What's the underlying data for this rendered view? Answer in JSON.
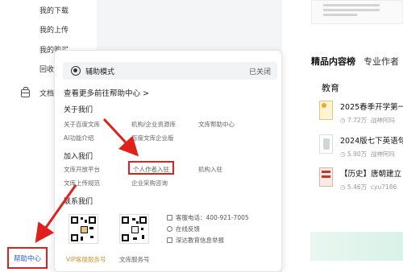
{
  "sidebar": {
    "items": [
      {
        "label": "我的下载"
      },
      {
        "label": "我的上传"
      },
      {
        "label": "我的购买"
      },
      {
        "label": "回收站"
      }
    ],
    "doc_label": "文档",
    "help_center": "帮助中心"
  },
  "popup": {
    "accessibility_label": "辅助模式",
    "accessibility_status": "已关闭",
    "more_link": "查看更多前往帮助中心 >",
    "about": {
      "title": "关于我们",
      "links": [
        "关于百度文库",
        "机构/企业资源库",
        "文库帮助中心",
        "AI功能介绍",
        "百度文库企业版"
      ]
    },
    "join": {
      "title": "加入我们",
      "links": [
        "文库开放平台",
        "个人作者入驻",
        "机构入驻",
        "文库上传规范",
        "企业采购咨询"
      ]
    },
    "contact": {
      "title": "联系我们",
      "qr_captions": [
        "VIP客服服务号",
        "文库服务号"
      ],
      "hotline": "客服电话：400-921-7005",
      "online": "在线反馈",
      "report": "深达教育信息举报"
    }
  },
  "content": {
    "tabs": [
      "精品内容榜",
      "专业作者"
    ],
    "section": "教育",
    "docs": [
      {
        "title": "2025春季开学第一",
        "views": "7.72万",
        "author": "战神阿玛"
      },
      {
        "title": "2024版七下英语句",
        "views": "5.90万",
        "author": "战神阿玛"
      },
      {
        "title": "【历史】唐朝建立",
        "views": "5.46万",
        "author": "cyu7186"
      }
    ]
  },
  "colors": {
    "highlight": "#e0211b",
    "link_blue": "#2a63d8",
    "vip_gold": "#c99a3d"
  }
}
